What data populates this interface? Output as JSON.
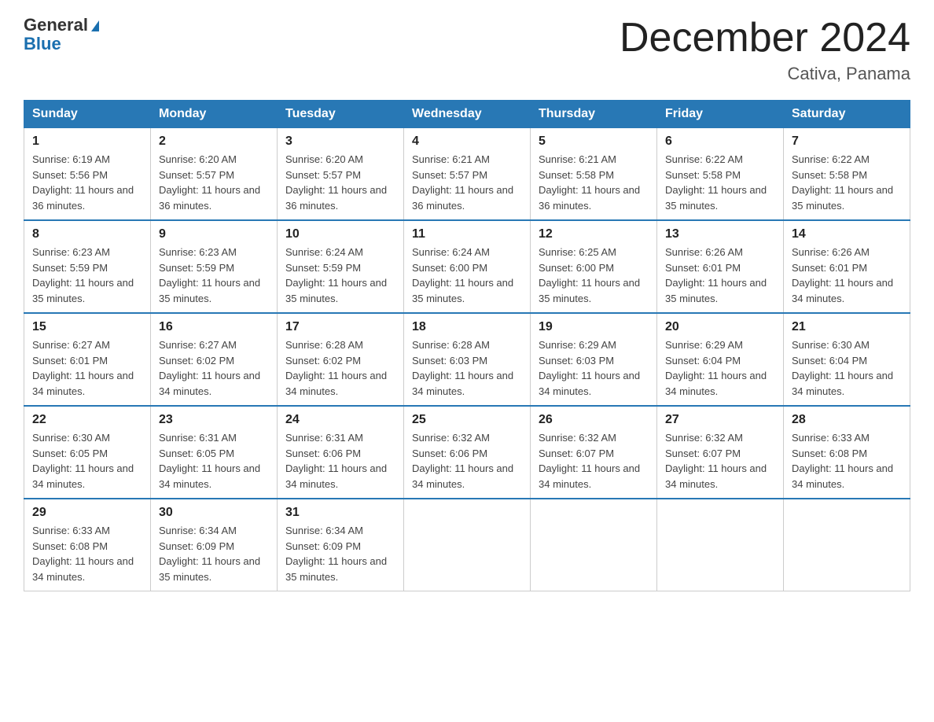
{
  "logo": {
    "line1": "General",
    "line2": "Blue"
  },
  "title": "December 2024",
  "location": "Cativa, Panama",
  "headers": [
    "Sunday",
    "Monday",
    "Tuesday",
    "Wednesday",
    "Thursday",
    "Friday",
    "Saturday"
  ],
  "weeks": [
    [
      {
        "day": "1",
        "sunrise": "Sunrise: 6:19 AM",
        "sunset": "Sunset: 5:56 PM",
        "daylight": "Daylight: 11 hours and 36 minutes."
      },
      {
        "day": "2",
        "sunrise": "Sunrise: 6:20 AM",
        "sunset": "Sunset: 5:57 PM",
        "daylight": "Daylight: 11 hours and 36 minutes."
      },
      {
        "day": "3",
        "sunrise": "Sunrise: 6:20 AM",
        "sunset": "Sunset: 5:57 PM",
        "daylight": "Daylight: 11 hours and 36 minutes."
      },
      {
        "day": "4",
        "sunrise": "Sunrise: 6:21 AM",
        "sunset": "Sunset: 5:57 PM",
        "daylight": "Daylight: 11 hours and 36 minutes."
      },
      {
        "day": "5",
        "sunrise": "Sunrise: 6:21 AM",
        "sunset": "Sunset: 5:58 PM",
        "daylight": "Daylight: 11 hours and 36 minutes."
      },
      {
        "day": "6",
        "sunrise": "Sunrise: 6:22 AM",
        "sunset": "Sunset: 5:58 PM",
        "daylight": "Daylight: 11 hours and 35 minutes."
      },
      {
        "day": "7",
        "sunrise": "Sunrise: 6:22 AM",
        "sunset": "Sunset: 5:58 PM",
        "daylight": "Daylight: 11 hours and 35 minutes."
      }
    ],
    [
      {
        "day": "8",
        "sunrise": "Sunrise: 6:23 AM",
        "sunset": "Sunset: 5:59 PM",
        "daylight": "Daylight: 11 hours and 35 minutes."
      },
      {
        "day": "9",
        "sunrise": "Sunrise: 6:23 AM",
        "sunset": "Sunset: 5:59 PM",
        "daylight": "Daylight: 11 hours and 35 minutes."
      },
      {
        "day": "10",
        "sunrise": "Sunrise: 6:24 AM",
        "sunset": "Sunset: 5:59 PM",
        "daylight": "Daylight: 11 hours and 35 minutes."
      },
      {
        "day": "11",
        "sunrise": "Sunrise: 6:24 AM",
        "sunset": "Sunset: 6:00 PM",
        "daylight": "Daylight: 11 hours and 35 minutes."
      },
      {
        "day": "12",
        "sunrise": "Sunrise: 6:25 AM",
        "sunset": "Sunset: 6:00 PM",
        "daylight": "Daylight: 11 hours and 35 minutes."
      },
      {
        "day": "13",
        "sunrise": "Sunrise: 6:26 AM",
        "sunset": "Sunset: 6:01 PM",
        "daylight": "Daylight: 11 hours and 35 minutes."
      },
      {
        "day": "14",
        "sunrise": "Sunrise: 6:26 AM",
        "sunset": "Sunset: 6:01 PM",
        "daylight": "Daylight: 11 hours and 34 minutes."
      }
    ],
    [
      {
        "day": "15",
        "sunrise": "Sunrise: 6:27 AM",
        "sunset": "Sunset: 6:01 PM",
        "daylight": "Daylight: 11 hours and 34 minutes."
      },
      {
        "day": "16",
        "sunrise": "Sunrise: 6:27 AM",
        "sunset": "Sunset: 6:02 PM",
        "daylight": "Daylight: 11 hours and 34 minutes."
      },
      {
        "day": "17",
        "sunrise": "Sunrise: 6:28 AM",
        "sunset": "Sunset: 6:02 PM",
        "daylight": "Daylight: 11 hours and 34 minutes."
      },
      {
        "day": "18",
        "sunrise": "Sunrise: 6:28 AM",
        "sunset": "Sunset: 6:03 PM",
        "daylight": "Daylight: 11 hours and 34 minutes."
      },
      {
        "day": "19",
        "sunrise": "Sunrise: 6:29 AM",
        "sunset": "Sunset: 6:03 PM",
        "daylight": "Daylight: 11 hours and 34 minutes."
      },
      {
        "day": "20",
        "sunrise": "Sunrise: 6:29 AM",
        "sunset": "Sunset: 6:04 PM",
        "daylight": "Daylight: 11 hours and 34 minutes."
      },
      {
        "day": "21",
        "sunrise": "Sunrise: 6:30 AM",
        "sunset": "Sunset: 6:04 PM",
        "daylight": "Daylight: 11 hours and 34 minutes."
      }
    ],
    [
      {
        "day": "22",
        "sunrise": "Sunrise: 6:30 AM",
        "sunset": "Sunset: 6:05 PM",
        "daylight": "Daylight: 11 hours and 34 minutes."
      },
      {
        "day": "23",
        "sunrise": "Sunrise: 6:31 AM",
        "sunset": "Sunset: 6:05 PM",
        "daylight": "Daylight: 11 hours and 34 minutes."
      },
      {
        "day": "24",
        "sunrise": "Sunrise: 6:31 AM",
        "sunset": "Sunset: 6:06 PM",
        "daylight": "Daylight: 11 hours and 34 minutes."
      },
      {
        "day": "25",
        "sunrise": "Sunrise: 6:32 AM",
        "sunset": "Sunset: 6:06 PM",
        "daylight": "Daylight: 11 hours and 34 minutes."
      },
      {
        "day": "26",
        "sunrise": "Sunrise: 6:32 AM",
        "sunset": "Sunset: 6:07 PM",
        "daylight": "Daylight: 11 hours and 34 minutes."
      },
      {
        "day": "27",
        "sunrise": "Sunrise: 6:32 AM",
        "sunset": "Sunset: 6:07 PM",
        "daylight": "Daylight: 11 hours and 34 minutes."
      },
      {
        "day": "28",
        "sunrise": "Sunrise: 6:33 AM",
        "sunset": "Sunset: 6:08 PM",
        "daylight": "Daylight: 11 hours and 34 minutes."
      }
    ],
    [
      {
        "day": "29",
        "sunrise": "Sunrise: 6:33 AM",
        "sunset": "Sunset: 6:08 PM",
        "daylight": "Daylight: 11 hours and 34 minutes."
      },
      {
        "day": "30",
        "sunrise": "Sunrise: 6:34 AM",
        "sunset": "Sunset: 6:09 PM",
        "daylight": "Daylight: 11 hours and 35 minutes."
      },
      {
        "day": "31",
        "sunrise": "Sunrise: 6:34 AM",
        "sunset": "Sunset: 6:09 PM",
        "daylight": "Daylight: 11 hours and 35 minutes."
      },
      null,
      null,
      null,
      null
    ]
  ]
}
